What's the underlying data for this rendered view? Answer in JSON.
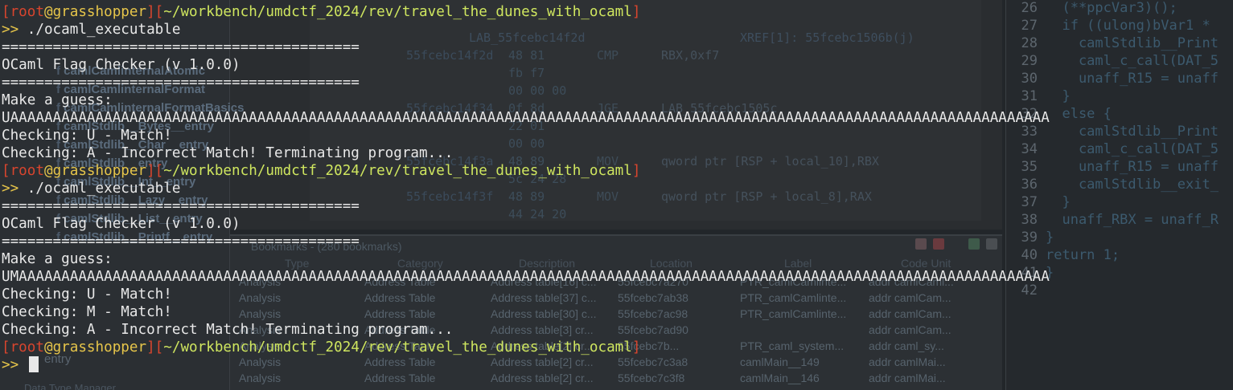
{
  "terminal": {
    "lines": [
      {
        "type": "prompt",
        "user": "root",
        "host": "grasshopper",
        "path": "~/workbench/umdctf_2024/rev/travel_the_dunes_with_ocaml"
      },
      {
        "type": "cmd",
        "prompt": ">>",
        "text": " ./ocaml_executable"
      },
      {
        "type": "out",
        "text": "=========================================="
      },
      {
        "type": "out",
        "text": "OCaml Flag Checker (v 1.0.0)"
      },
      {
        "type": "out",
        "text": "=========================================="
      },
      {
        "type": "out",
        "text": "Make a guess:"
      },
      {
        "type": "out",
        "text": "UAAAAAAAAAAAAAAAAAAAAAAAAAAAAAAAAAAAAAAAAAAAAAAAAAAAAAAAAAAAAAAAAAAAAAAAAAAAAAAAAAAAAAAAAAAAAAAAAAAAAAAAAAAAAAAAAAAAAAAAAAA"
      },
      {
        "type": "out",
        "text": "Checking: U - Match!"
      },
      {
        "type": "out",
        "text": "Checking: A - Incorrect Match! Terminating program..."
      },
      {
        "type": "prompt",
        "user": "root",
        "host": "grasshopper",
        "path": "~/workbench/umdctf_2024/rev/travel_the_dunes_with_ocaml"
      },
      {
        "type": "cmd",
        "prompt": ">>",
        "text": " ./ocaml_executable"
      },
      {
        "type": "out",
        "text": "=========================================="
      },
      {
        "type": "out",
        "text": "OCaml Flag Checker (v 1.0.0)"
      },
      {
        "type": "out",
        "text": "=========================================="
      },
      {
        "type": "out",
        "text": "Make a guess:"
      },
      {
        "type": "out",
        "text": "UMAAAAAAAAAAAAAAAAAAAAAAAAAAAAAAAAAAAAAAAAAAAAAAAAAAAAAAAAAAAAAAAAAAAAAAAAAAAAAAAAAAAAAAAAAAAAAAAAAAAAAAAAAAAAAAAAAAAAAAAAA"
      },
      {
        "type": "out",
        "text": "Checking: U - Match!"
      },
      {
        "type": "out",
        "text": "Checking: M - Match!"
      },
      {
        "type": "out",
        "text": "Checking: A - Incorrect Match! Terminating program..."
      },
      {
        "type": "prompt",
        "user": "root",
        "host": "grasshopper",
        "path": "~/workbench/umdctf_2024/rev/travel_the_dunes_with_ocaml"
      },
      {
        "type": "cmd",
        "prompt": ">>",
        "text": " "
      }
    ]
  },
  "background": {
    "symbol_tree": {
      "items": [
        {
          "label": "camlCamlinternalAtomic"
        },
        {
          "label": "camlCamlinternalFormat"
        },
        {
          "label": "camlCamlinternalFormatBasics"
        },
        {
          "label": "camlStdlib__Bytes__entry"
        },
        {
          "label": "camlStdlib__Char__entry"
        },
        {
          "label": "camlStdlib__entry"
        },
        {
          "label": "camlStdlib__Int__entry"
        },
        {
          "label": "camlStdlib__Lazy__entry"
        },
        {
          "label": "camlStdlib__List__entry"
        },
        {
          "label": "camlStdlib__Printf__entry"
        }
      ],
      "filter_value": "entry"
    },
    "listing": {
      "rows": [
        {
          "label": "LAB_55fcebc14f2d",
          "xref": "XREF[1]: 55fcebc1506b(j)"
        },
        {
          "addr": "55fcebc14f2d",
          "bytes": "48 81",
          "mn": "CMP",
          "op": "RBX,0xf7"
        },
        {
          "bytes": "fb f7"
        },
        {
          "bytes": "00 00 00"
        },
        {
          "addr": "55fcebc14f34",
          "bytes": "0f 8d",
          "mn": "JGE",
          "op": "LAB_55fcebc1505c"
        },
        {
          "bytes": "22 01"
        },
        {
          "bytes": "00 00"
        },
        {
          "addr": "55fcebc14f3a",
          "bytes": "48 89",
          "mn": "MOV",
          "op": "qword ptr [RSP + local_10],RBX"
        },
        {
          "bytes": "5c 24 28"
        },
        {
          "addr": "55fcebc14f3f",
          "bytes": "48 89",
          "mn": "MOV",
          "op": "qword ptr [RSP + local_8],RAX"
        },
        {
          "bytes": "44 24 20"
        }
      ]
    },
    "bookmarks": {
      "title": "Bookmarks - (280 bookmarks)",
      "columns": [
        "Type",
        "Category",
        "Description",
        "Location",
        "Label",
        "Code Unit"
      ],
      "rows": [
        {
          "type": "Analysis",
          "category": "Address Table",
          "description": "Address table[16] c...",
          "location": "55fcebc7a270",
          "label": "PTR_camlCamlinte...",
          "code": "addr camlCaml..."
        },
        {
          "type": "Analysis",
          "category": "Address Table",
          "description": "Address table[37] c...",
          "location": "55fcebc7ab38",
          "label": "PTR_camlCamlinte...",
          "code": "addr camlCam..."
        },
        {
          "type": "Analysis",
          "category": "Address Table",
          "description": "Address table[30] c...",
          "location": "55fcebc7ac98",
          "label": "PTR_camlCamlinte...",
          "code": "addr camlCam..."
        },
        {
          "type": "Analysis",
          "category": "Address Table",
          "description": "Address table[3] cr...",
          "location": "55fcebc7ad90",
          "label": "",
          "code": "addr camlCam..."
        },
        {
          "type": "Analysis",
          "category": "Address Table",
          "description": "Address table[2] cr...",
          "location": "55fcebc7b...",
          "label": "PTR_caml_system...",
          "code": "addr caml_sy..."
        },
        {
          "type": "Analysis",
          "category": "Address Table",
          "description": "Address table[2] cr...",
          "location": "55fcebc7c3a8",
          "label": "camlMain__149",
          "code": "addr camlMai..."
        },
        {
          "type": "Analysis",
          "category": "Address Table",
          "description": "Address table[2] cr...",
          "location": "55fcebc7c3f8",
          "label": "camlMain__146",
          "code": "addr camlMai..."
        }
      ]
    },
    "decompiler": {
      "lines": [
        {
          "n": "26",
          "code": "  (**ppcVar3)();"
        },
        {
          "n": "27",
          "code": "  if ((ulong)bVar1 * "
        },
        {
          "n": "28",
          "code": "    camlStdlib__Print"
        },
        {
          "n": "29",
          "code": "    caml_c_call(DAT_5"
        },
        {
          "n": "30",
          "code": "    unaff_R15 = unaff"
        },
        {
          "n": "31",
          "code": "  }"
        },
        {
          "n": "32",
          "code": "  else {"
        },
        {
          "n": "33",
          "code": "    camlStdlib__Print"
        },
        {
          "n": "34",
          "code": "    caml_c_call(DAT_5"
        },
        {
          "n": "35",
          "code": "    unaff_R15 = unaff"
        },
        {
          "n": "36",
          "code": "    camlStdlib__exit_"
        },
        {
          "n": "37",
          "code": "  }"
        },
        {
          "n": "38",
          "code": "  unaff_RBX = unaff_R"
        },
        {
          "n": "39",
          "code": "}"
        },
        {
          "n": "40",
          "code": "return 1;"
        },
        {
          "n": "41",
          "code": "}"
        },
        {
          "n": "42",
          "code": ""
        }
      ]
    },
    "data_type_manager_title": "Data Type Manager",
    "colors": {
      "terminal_bg": "#22262a",
      "prompt_red": "#d8452e",
      "prompt_yellow": "#e6c54a",
      "path_green": "#cfe65f",
      "text": "#e8e8e8"
    }
  }
}
